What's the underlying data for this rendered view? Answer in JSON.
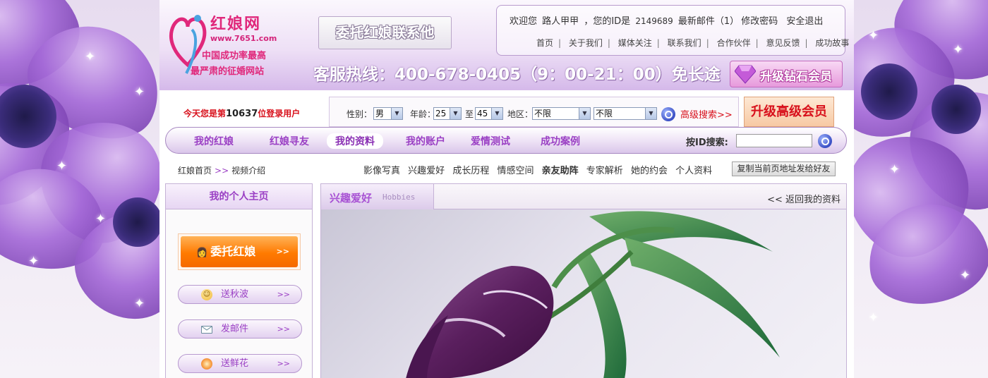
{
  "logo": {
    "title": "红娘网",
    "url": "www.7651.com",
    "slogan1": "中国成功率最高",
    "slogan2": "最严肃的征婚网站"
  },
  "header": {
    "entrust_label": "委托红娘联系他",
    "welcome": "欢迎您",
    "username": "路人甲甲",
    "id_label": "，您的ID是",
    "user_id": "2149689",
    "mail": "最新邮件（1）",
    "change_pwd": "修改密码",
    "logout": "安全退出",
    "links": [
      "首页",
      "关于我们",
      "媒体关注",
      "联系我们",
      "合作伙伴",
      "意见反馈",
      "成功故事"
    ],
    "hotline": "客服热线：400-678-0405（9：00-21：00）免长途",
    "upgrade_diamond": "升级钻石会员"
  },
  "search": {
    "count_prefix": "今天您是第",
    "count_value": "10637",
    "count_suffix": "位登录用户",
    "gender_label": "性别：",
    "gender_value": "男",
    "age_label": "年龄：",
    "age_from": "25",
    "age_to_label": "至",
    "age_to": "45",
    "region_label": "地区：",
    "region1": "不限",
    "region2": "不限",
    "advanced": "高级搜索>>",
    "upgrade_senior": "升级高级会员"
  },
  "nav": {
    "items": [
      "我的红娘",
      "红娘寻友",
      "我的资料",
      "我的账户",
      "爱情测试",
      "成功案例"
    ],
    "active_index": 2,
    "id_search_label": "按ID搜索:"
  },
  "breadcrumb": {
    "home": "红娘首页",
    "sep": ">>",
    "current": "视频介绍"
  },
  "subnav": [
    "影像写真",
    "兴趣爱好",
    "成长历程",
    "情感空间",
    "亲友助阵",
    "专家解析",
    "她的约会",
    "个人资料"
  ],
  "subnav_bold_index": 4,
  "copy_button": "复制当前页地址发给好友",
  "sidebar": {
    "title": "我的个人主页",
    "entrust": "委托红娘",
    "chevron": ">>",
    "buttons": [
      {
        "label": "送秋波",
        "icon": "smile-icon"
      },
      {
        "label": "发邮件",
        "icon": "envelope-icon"
      },
      {
        "label": "送鲜花",
        "icon": "flower-icon"
      }
    ]
  },
  "main": {
    "tab_title": "兴趣爱好",
    "tab_en": "Hobbies",
    "back_link": "<< 返回我的资料"
  },
  "colors": {
    "brand_pink": "#e0287b",
    "brand_purple": "#9a3fc4",
    "alert_red": "#d8101b",
    "orange": "#ff7a00"
  }
}
